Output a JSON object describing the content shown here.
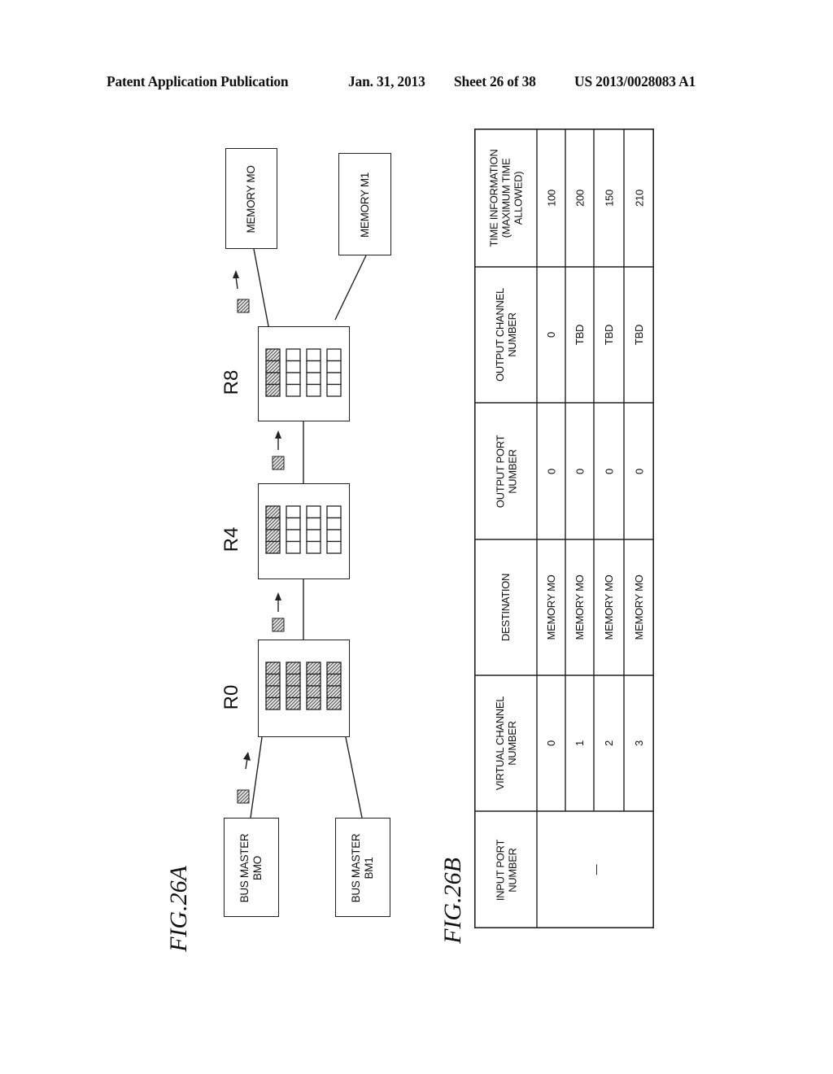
{
  "header": {
    "publication": "Patent Application Publication",
    "date": "Jan. 31, 2013",
    "sheet": "Sheet 26 of 38",
    "pub_number": "US 2013/0028083 A1"
  },
  "fig_a": {
    "label": "FIG.26A",
    "bus_masters": [
      {
        "line1": "BUS MASTER",
        "line2": "BMO"
      },
      {
        "line1": "BUS MASTER",
        "line2": "BM1"
      }
    ],
    "routers": [
      {
        "label": "R0",
        "filled_buffers": 4,
        "total_buffers": 4,
        "slots_per_buffer": 4
      },
      {
        "label": "R4",
        "filled_buffers": 1,
        "total_buffers": 4,
        "slots_per_buffer": 4
      },
      {
        "label": "R8",
        "filled_buffers": 1,
        "total_buffers": 4,
        "slots_per_buffer": 4
      }
    ],
    "memories": [
      {
        "label": "MEMORY MO"
      },
      {
        "label": "MEMORY M1"
      }
    ],
    "packet_icon": "hatched-square",
    "arrow_icon": "arrow-up"
  },
  "fig_b": {
    "label": "FIG.26B",
    "columns": [
      {
        "header": [
          "INPUT PORT",
          "NUMBER"
        ]
      },
      {
        "header": [
          "VIRTUAL CHANNEL",
          "NUMBER"
        ]
      },
      {
        "header": [
          "DESTINATION"
        ]
      },
      {
        "header": [
          "OUTPUT PORT",
          "NUMBER"
        ]
      },
      {
        "header": [
          "OUTPUT CHANNEL",
          "NUMBER"
        ]
      },
      {
        "header": [
          "TIME INFORMATION",
          "(MAXIMUM TIME",
          "ALLOWED)"
        ]
      }
    ],
    "input_port_value": "—",
    "rows": [
      {
        "virtual_channel": "0",
        "destination": "MEMORY MO",
        "output_port": "0",
        "output_channel": "0",
        "time": "100"
      },
      {
        "virtual_channel": "1",
        "destination": "MEMORY MO",
        "output_port": "0",
        "output_channel": "TBD",
        "time": "200"
      },
      {
        "virtual_channel": "2",
        "destination": "MEMORY MO",
        "output_port": "0",
        "output_channel": "TBD",
        "time": "150"
      },
      {
        "virtual_channel": "3",
        "destination": "MEMORY MO",
        "output_port": "0",
        "output_channel": "TBD",
        "time": "210"
      }
    ]
  }
}
